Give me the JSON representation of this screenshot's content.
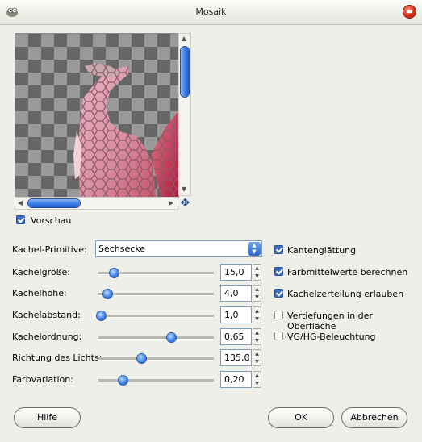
{
  "window": {
    "title": "Mosaik",
    "close_icon": "close-icon"
  },
  "preview": {
    "checkbox_label": "Vorschau",
    "checkbox_checked": true,
    "vscroll_value_fraction": 0.1,
    "hscroll_value_fraction": 0.1
  },
  "controls": {
    "tile_primitive": {
      "label": "Kachel-Primitive:",
      "value": "Sechsecke"
    },
    "sliders": [
      {
        "label": "Kachelgröße:",
        "value": "15,0",
        "fraction": 0.13
      },
      {
        "label": "Kachelhöhe:",
        "value": "4,0",
        "fraction": 0.08
      },
      {
        "label": "Kachelabstand:",
        "value": "1,0",
        "fraction": 0.02
      },
      {
        "label": "Kachelordnung:",
        "value": "0,65",
        "fraction": 0.63
      },
      {
        "label": "Richtung des Lichts:",
        "value": "135,0",
        "fraction": 0.37
      },
      {
        "label": "Farbvariation:",
        "value": "0,20",
        "fraction": 0.21
      }
    ]
  },
  "options": [
    {
      "label": "Kantenglättung",
      "checked": true
    },
    {
      "label": "Farbmittelwerte berechnen",
      "checked": true
    },
    {
      "label": "Kachelzerteilung erlauben",
      "checked": true
    },
    {
      "label": "Vertiefungen in der Oberfläche",
      "checked": false
    },
    {
      "label": "VG/HG-Beleuchtung",
      "checked": false
    }
  ],
  "buttons": {
    "help": "Hilfe",
    "ok": "OK",
    "cancel": "Abbrechen"
  }
}
